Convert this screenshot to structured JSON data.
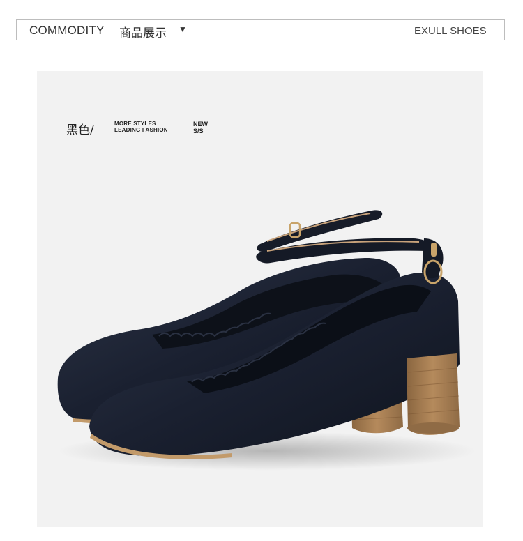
{
  "header": {
    "title_en": "COMMODITY",
    "title_cn": "商品展示",
    "dropdown_icon": "triangle-down-icon",
    "brand": "EXULL SHOES"
  },
  "product": {
    "color_label": "黑色/",
    "tagline_line1": "MORE STYLES",
    "tagline_line2": "LEADING FASHION",
    "season_line1": "NEW",
    "season_line2": "S/S",
    "image_description_icon": "black-ankle-strap-shoe-image"
  },
  "colors": {
    "panel_bg": "#f2f2f2",
    "border": "#bdbdbd",
    "leather": "#1c2230",
    "heel": "#a07a50"
  }
}
